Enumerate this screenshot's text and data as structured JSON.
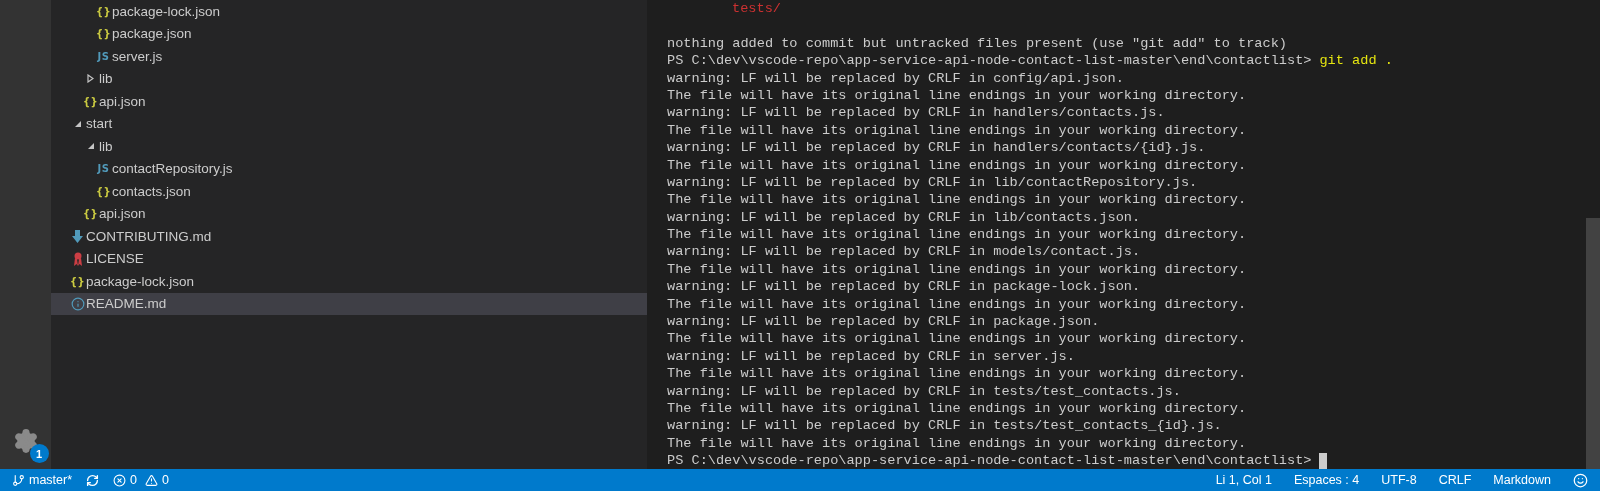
{
  "activity_bar": {
    "settings_badge": "1"
  },
  "tree": [
    {
      "children": [
        {
          "children": [
            {
              "kind": "json",
              "icon_text": "{}",
              "label": "package-lock.json",
              "selected": false
            },
            {
              "kind": "json",
              "icon_text": "{}",
              "label": "package.json",
              "selected": false
            },
            {
              "kind": "js",
              "icon_text": "JS",
              "label": "server.js",
              "selected": false
            }
          ]
        },
        {
          "kind": "folder",
          "label": "lib",
          "expanded": false,
          "selected": false
        },
        {
          "kind": "json",
          "icon_text": "{}",
          "label": "api.json",
          "selected": false
        }
      ]
    },
    {
      "kind": "folder",
      "label": "start",
      "expanded": true,
      "selected": false,
      "children": [
        {
          "kind": "folder",
          "label": "lib",
          "expanded": true,
          "selected": false,
          "children": [
            {
              "kind": "js",
              "icon_text": "JS",
              "label": "contactRepository.js",
              "selected": false
            },
            {
              "kind": "json",
              "icon_text": "{}",
              "label": "contacts.json",
              "selected": false
            }
          ]
        },
        {
          "kind": "json",
          "icon_text": "{}",
          "label": "api.json",
          "selected": false
        }
      ]
    },
    {
      "kind": "markdown",
      "label": "CONTRIBUTING.md",
      "selected": false
    },
    {
      "kind": "license",
      "label": "LICENSE",
      "selected": false
    },
    {
      "kind": "json",
      "icon_text": "{}",
      "label": "package-lock.json",
      "selected": false
    },
    {
      "kind": "info",
      "label": "README.md",
      "selected": true
    }
  ],
  "terminal": {
    "lines": [
      {
        "kind": "untracked",
        "text": "tests/"
      },
      {
        "kind": "blank"
      },
      {
        "kind": "text",
        "text": "nothing added to commit but untracked files present (use \"git add\" to track)"
      },
      {
        "kind": "prompt",
        "prompt": "PS C:\\dev\\vscode-repo\\app-service-api-node-contact-list-master\\end\\contactlist>",
        "command": "git add .",
        "cursor": false
      },
      {
        "kind": "text",
        "text": "warning: LF will be replaced by CRLF in config/api.json."
      },
      {
        "kind": "text",
        "text": "The file will have its original line endings in your working directory."
      },
      {
        "kind": "text",
        "text": "warning: LF will be replaced by CRLF in handlers/contacts.js."
      },
      {
        "kind": "text",
        "text": "The file will have its original line endings in your working directory."
      },
      {
        "kind": "text",
        "text": "warning: LF will be replaced by CRLF in handlers/contacts/{id}.js."
      },
      {
        "kind": "text",
        "text": "The file will have its original line endings in your working directory."
      },
      {
        "kind": "text",
        "text": "warning: LF will be replaced by CRLF in lib/contactRepository.js."
      },
      {
        "kind": "text",
        "text": "The file will have its original line endings in your working directory."
      },
      {
        "kind": "text",
        "text": "warning: LF will be replaced by CRLF in lib/contacts.json."
      },
      {
        "kind": "text",
        "text": "The file will have its original line endings in your working directory."
      },
      {
        "kind": "text",
        "text": "warning: LF will be replaced by CRLF in models/contact.js."
      },
      {
        "kind": "text",
        "text": "The file will have its original line endings in your working directory."
      },
      {
        "kind": "text",
        "text": "warning: LF will be replaced by CRLF in package-lock.json."
      },
      {
        "kind": "text",
        "text": "The file will have its original line endings in your working directory."
      },
      {
        "kind": "text",
        "text": "warning: LF will be replaced by CRLF in package.json."
      },
      {
        "kind": "text",
        "text": "The file will have its original line endings in your working directory."
      },
      {
        "kind": "text",
        "text": "warning: LF will be replaced by CRLF in server.js."
      },
      {
        "kind": "text",
        "text": "The file will have its original line endings in your working directory."
      },
      {
        "kind": "text",
        "text": "warning: LF will be replaced by CRLF in tests/test_contacts.js."
      },
      {
        "kind": "text",
        "text": "The file will have its original line endings in your working directory."
      },
      {
        "kind": "text",
        "text": "warning: LF will be replaced by CRLF in tests/test_contacts_{id}.js."
      },
      {
        "kind": "text",
        "text": "The file will have its original line endings in your working directory."
      },
      {
        "kind": "prompt",
        "prompt": "PS C:\\dev\\vscode-repo\\app-service-api-node-contact-list-master\\end\\contactlist>",
        "cursor": true
      }
    ]
  },
  "status_bar": {
    "left": [
      {
        "kind": "branch",
        "text": "master*"
      },
      {
        "kind": "sync"
      },
      {
        "kind": "problems",
        "errors": "0",
        "warnings": "0"
      }
    ],
    "right": [
      "Li 1, Col 1",
      "Espaces : 4",
      "UTF-8",
      "CRLF",
      "Markdown"
    ]
  }
}
